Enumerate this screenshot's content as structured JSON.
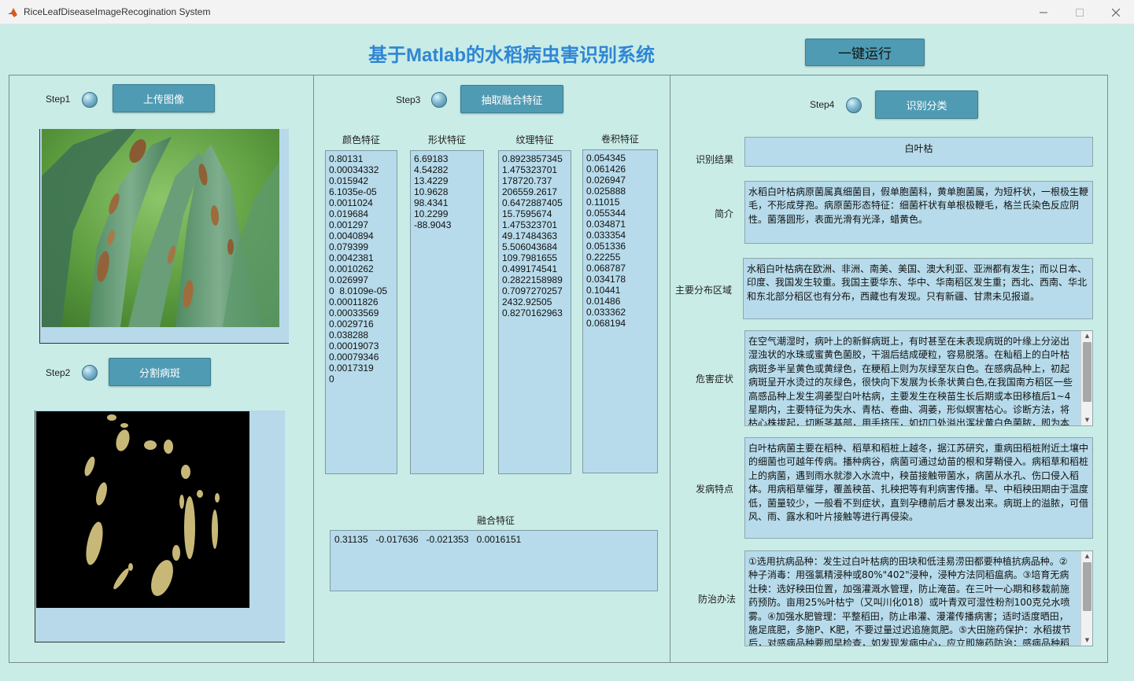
{
  "window": {
    "title": "RiceLeafDiseaseImageRecogination System"
  },
  "app": {
    "title": "基于Matlab的水稻病虫害识别系统",
    "run_button": "一键运行"
  },
  "step1": {
    "label": "Step1",
    "button": "上传图像"
  },
  "step2": {
    "label": "Step2",
    "button": "分割病斑"
  },
  "step3": {
    "label": "Step3",
    "button": "抽取融合特征"
  },
  "step4": {
    "label": "Step4",
    "button": "识别分类"
  },
  "features": {
    "color": {
      "header": "颜色特征",
      "values": [
        "0.80131",
        "0.00034332",
        "0.015942",
        "6.1035e-05",
        "0.0011024",
        "0.019684",
        "0.001297",
        "0.0040894",
        "0.079399",
        "0.0042381",
        "0.0010262",
        "0.026997",
        "0  8.0109e-05",
        "0.00011826",
        "0.00033569",
        "0.0029716",
        "0.038288",
        "0.00019073",
        "0.00079346",
        "0.0017319",
        "0"
      ]
    },
    "shape": {
      "header": "形状特征",
      "values": [
        "6.69183",
        "4.54282",
        "13.4229",
        "10.9628",
        "98.4341",
        "10.2299",
        "-88.9043"
      ]
    },
    "texture": {
      "header": "纹理特征",
      "values": [
        "0.8923857345",
        "1.475323701",
        "178720.737",
        "206559.2617",
        "0.6472887405",
        "15.7595674",
        "1.475323701",
        "49.17484363",
        "5.506043684",
        "109.7981655",
        "0.499174541",
        "0.2822158989",
        "0.7097270257",
        "2432.92505",
        "0.8270162963"
      ]
    },
    "conv": {
      "header": "卷积特征",
      "values": [
        "0.054345",
        "0.061426",
        "0.026947",
        "0.025888",
        "0.11015",
        "0.055344",
        "0.034871",
        "0.033354",
        "0.051336",
        "0.22255",
        "0.068787",
        "0.034178",
        "0.10441",
        "0.01486",
        "0.033362",
        "0.068194"
      ]
    },
    "fused": {
      "header": "融合特征",
      "value": "0.31135   -0.017636   -0.021353   0.0016151"
    }
  },
  "result": {
    "label": "识别结果",
    "value": "白叶枯",
    "intro_label": "简介",
    "intro": "水稻白叶枯病原菌属真细菌目，假单胞菌科，黄单胞菌属，为短杆状，一根极生鞭毛，不形成芽孢。病原菌形态特征：细菌杆状有单根极鞭毛，格兰氏染色反应阴性。菌落圆形，表面光滑有光泽，蜡黄色。",
    "region_label": "主要分布区域",
    "region": "水稻白叶枯病在欧洲、非洲、南美、美国、澳大利亚、亚洲都有发生；而以日本、印度、我国发生较重。我国主要华东、华中、华南稻区发生重；西北、西南、华北和东北部分稻区也有分布，西藏也有发现。只有新疆、甘肃未见报道。",
    "symptom_label": "危害症状",
    "symptom": "在空气潮湿时，病叶上的新鲜病斑上，有时甚至在未表现病斑的叶缘上分泌出湿浊状的水珠或蜜黄色菌胶，干涸后结成硬粒，容易脱落。在籼稻上的白叶枯病斑多半呈黄色或黄绿色，在粳稻上则为灰绿至灰白色。在感病品种上，初起病斑呈开水烫过的灰绿色，很快向下发展为长条状黄白色,在我国南方稻区一些高感品种上发生凋萎型白叶枯病，主要发生在秧苗生长后期或本田移植后1~4星期内，主要特征为失水、青枯、卷曲、凋萎，形似螟害枯心。诊断方法，将枯心株拔起，切断茎基部，用手挤压，如切口处溢出浑状黄白色菌脓，即为本",
    "feature_label": "发病特点",
    "feature": "白叶枯病菌主要在稻种、稻草和稻桩上越冬，据江苏研究，重病田稻桩附近土壤中的细菌也可越年传病。播种病谷，病菌可通过幼苗的根和芽鞘侵入。病稻草和稻桩上的病菌，遇到雨水就渗入水流中，秧苗接触带菌水，病菌从水孔、伤口侵入稻体。用病稻草催芽，覆盖秧苗、扎秧把等有利病害传播。早、中稻秧田期由于温度低，菌量较少，一般看不到症状，直到孕穗前后才暴发出来。病斑上的溢脓，可借风、雨、露水和叶片接触等进行再侵染。",
    "control_label": "防治办法",
    "control": "①选用抗病品种：发生过白叶枯病的田块和低洼易涝田都要种植抗病品种。②种子消毒：用强氯精浸种或80%\"402\"浸种，浸种方法同稻瘟病。③培育无病壮秧：选好秧田位置，加强灌溉水管理，防止淹苗。在三叶一心期和移栽前施药预防。亩用25%叶枯宁（又叫川化018）或叶青双可湿性粉剂100克兑水喷雾。④加强水肥管理：平整稻田，防止串灌、漫灌传播病害；适时适度晒田，施足底肥，多施P、K肥，不要过量过迟追施氮肥。⑤大田施药保护：水稻拔节后，对感病品种要即早检查，如发现发病中心，应立即施药防治；感病品种稻田在"
  }
}
